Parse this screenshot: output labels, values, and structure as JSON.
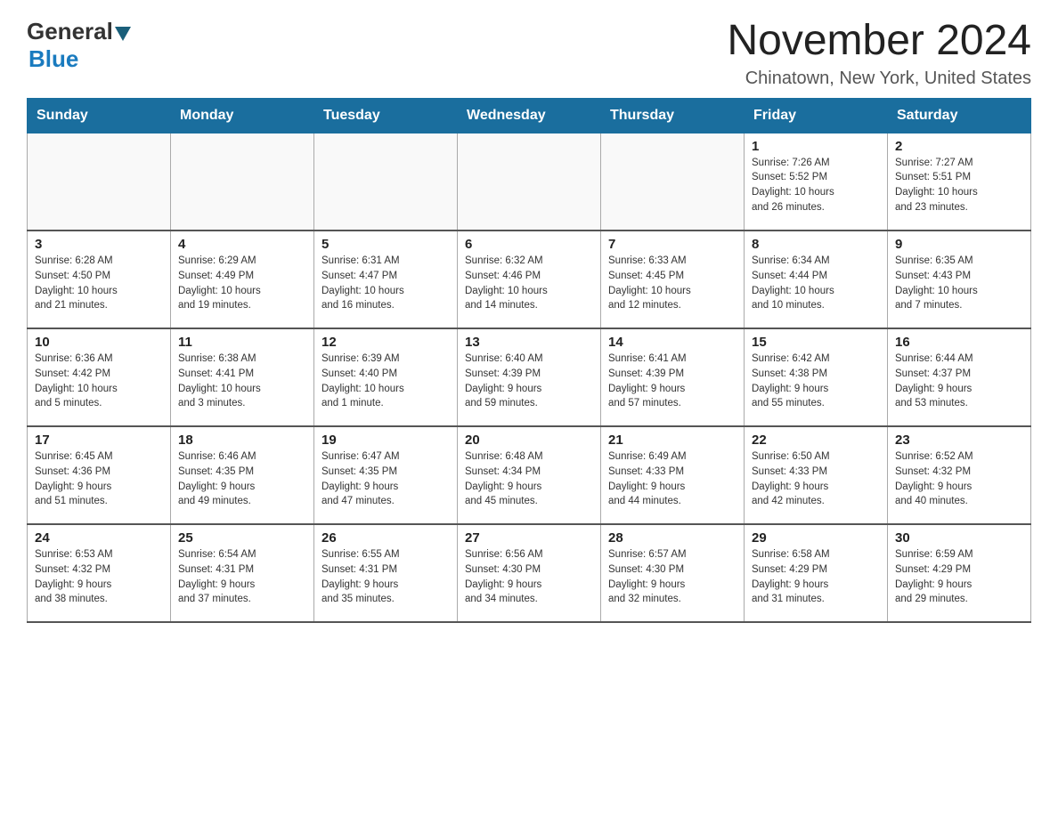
{
  "header": {
    "logo_text_general": "General",
    "logo_text_blue": "Blue",
    "month": "November 2024",
    "location": "Chinatown, New York, United States"
  },
  "weekdays": [
    "Sunday",
    "Monday",
    "Tuesday",
    "Wednesday",
    "Thursday",
    "Friday",
    "Saturday"
  ],
  "weeks": [
    {
      "days": [
        {
          "date": "",
          "info": ""
        },
        {
          "date": "",
          "info": ""
        },
        {
          "date": "",
          "info": ""
        },
        {
          "date": "",
          "info": ""
        },
        {
          "date": "",
          "info": ""
        },
        {
          "date": "1",
          "info": "Sunrise: 7:26 AM\nSunset: 5:52 PM\nDaylight: 10 hours\nand 26 minutes."
        },
        {
          "date": "2",
          "info": "Sunrise: 7:27 AM\nSunset: 5:51 PM\nDaylight: 10 hours\nand 23 minutes."
        }
      ]
    },
    {
      "days": [
        {
          "date": "3",
          "info": "Sunrise: 6:28 AM\nSunset: 4:50 PM\nDaylight: 10 hours\nand 21 minutes."
        },
        {
          "date": "4",
          "info": "Sunrise: 6:29 AM\nSunset: 4:49 PM\nDaylight: 10 hours\nand 19 minutes."
        },
        {
          "date": "5",
          "info": "Sunrise: 6:31 AM\nSunset: 4:47 PM\nDaylight: 10 hours\nand 16 minutes."
        },
        {
          "date": "6",
          "info": "Sunrise: 6:32 AM\nSunset: 4:46 PM\nDaylight: 10 hours\nand 14 minutes."
        },
        {
          "date": "7",
          "info": "Sunrise: 6:33 AM\nSunset: 4:45 PM\nDaylight: 10 hours\nand 12 minutes."
        },
        {
          "date": "8",
          "info": "Sunrise: 6:34 AM\nSunset: 4:44 PM\nDaylight: 10 hours\nand 10 minutes."
        },
        {
          "date": "9",
          "info": "Sunrise: 6:35 AM\nSunset: 4:43 PM\nDaylight: 10 hours\nand 7 minutes."
        }
      ]
    },
    {
      "days": [
        {
          "date": "10",
          "info": "Sunrise: 6:36 AM\nSunset: 4:42 PM\nDaylight: 10 hours\nand 5 minutes."
        },
        {
          "date": "11",
          "info": "Sunrise: 6:38 AM\nSunset: 4:41 PM\nDaylight: 10 hours\nand 3 minutes."
        },
        {
          "date": "12",
          "info": "Sunrise: 6:39 AM\nSunset: 4:40 PM\nDaylight: 10 hours\nand 1 minute."
        },
        {
          "date": "13",
          "info": "Sunrise: 6:40 AM\nSunset: 4:39 PM\nDaylight: 9 hours\nand 59 minutes."
        },
        {
          "date": "14",
          "info": "Sunrise: 6:41 AM\nSunset: 4:39 PM\nDaylight: 9 hours\nand 57 minutes."
        },
        {
          "date": "15",
          "info": "Sunrise: 6:42 AM\nSunset: 4:38 PM\nDaylight: 9 hours\nand 55 minutes."
        },
        {
          "date": "16",
          "info": "Sunrise: 6:44 AM\nSunset: 4:37 PM\nDaylight: 9 hours\nand 53 minutes."
        }
      ]
    },
    {
      "days": [
        {
          "date": "17",
          "info": "Sunrise: 6:45 AM\nSunset: 4:36 PM\nDaylight: 9 hours\nand 51 minutes."
        },
        {
          "date": "18",
          "info": "Sunrise: 6:46 AM\nSunset: 4:35 PM\nDaylight: 9 hours\nand 49 minutes."
        },
        {
          "date": "19",
          "info": "Sunrise: 6:47 AM\nSunset: 4:35 PM\nDaylight: 9 hours\nand 47 minutes."
        },
        {
          "date": "20",
          "info": "Sunrise: 6:48 AM\nSunset: 4:34 PM\nDaylight: 9 hours\nand 45 minutes."
        },
        {
          "date": "21",
          "info": "Sunrise: 6:49 AM\nSunset: 4:33 PM\nDaylight: 9 hours\nand 44 minutes."
        },
        {
          "date": "22",
          "info": "Sunrise: 6:50 AM\nSunset: 4:33 PM\nDaylight: 9 hours\nand 42 minutes."
        },
        {
          "date": "23",
          "info": "Sunrise: 6:52 AM\nSunset: 4:32 PM\nDaylight: 9 hours\nand 40 minutes."
        }
      ]
    },
    {
      "days": [
        {
          "date": "24",
          "info": "Sunrise: 6:53 AM\nSunset: 4:32 PM\nDaylight: 9 hours\nand 38 minutes."
        },
        {
          "date": "25",
          "info": "Sunrise: 6:54 AM\nSunset: 4:31 PM\nDaylight: 9 hours\nand 37 minutes."
        },
        {
          "date": "26",
          "info": "Sunrise: 6:55 AM\nSunset: 4:31 PM\nDaylight: 9 hours\nand 35 minutes."
        },
        {
          "date": "27",
          "info": "Sunrise: 6:56 AM\nSunset: 4:30 PM\nDaylight: 9 hours\nand 34 minutes."
        },
        {
          "date": "28",
          "info": "Sunrise: 6:57 AM\nSunset: 4:30 PM\nDaylight: 9 hours\nand 32 minutes."
        },
        {
          "date": "29",
          "info": "Sunrise: 6:58 AM\nSunset: 4:29 PM\nDaylight: 9 hours\nand 31 minutes."
        },
        {
          "date": "30",
          "info": "Sunrise: 6:59 AM\nSunset: 4:29 PM\nDaylight: 9 hours\nand 29 minutes."
        }
      ]
    }
  ]
}
